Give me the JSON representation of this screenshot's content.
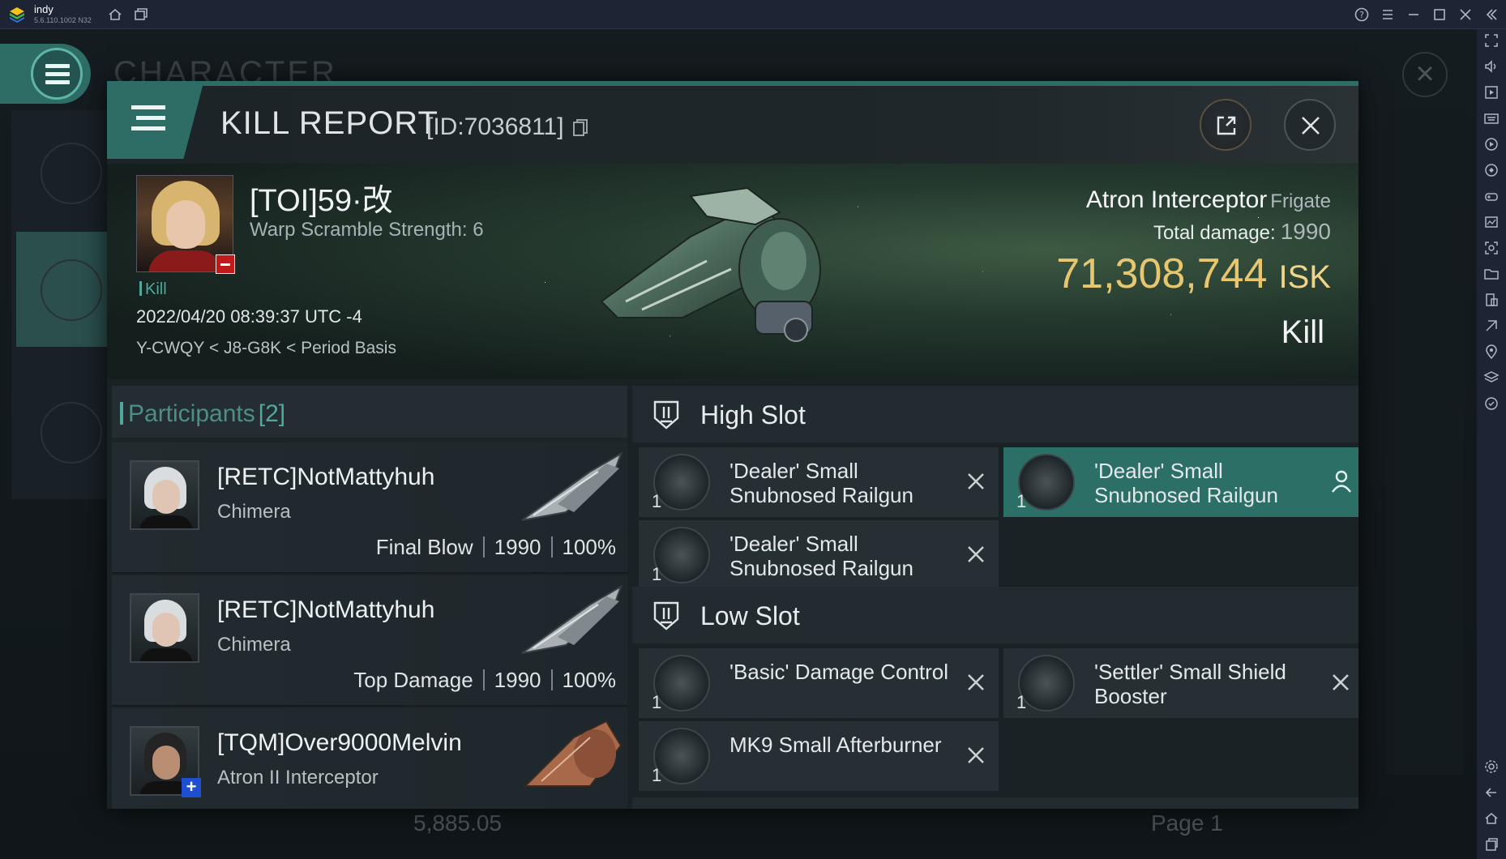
{
  "emulator": {
    "app_name": "indy",
    "app_version": "5.6.110.1002 N32"
  },
  "background": {
    "title": "CHARACTER",
    "bottom_value": "5,885.05",
    "page_label": "Page 1"
  },
  "dialog": {
    "title": "KILL REPORT",
    "id_text": "[ID:7036811]"
  },
  "victim": {
    "name": "[TOI]59·改",
    "warp_scramble": "Warp Scramble Strength: 6",
    "tag": "Kill",
    "timestamp": "2022/04/20 08:39:37 UTC -4",
    "location": "Y-CWQY < J8-G8K < Period Basis",
    "ship_name": "Atron Interceptor",
    "ship_class": "Frigate",
    "total_damage_label": "Total damage:",
    "total_damage_value": "1990",
    "isk_value": "71,308,744",
    "isk_unit": "ISK",
    "result": "Kill"
  },
  "participants": {
    "title": "Participants",
    "count": "[2]",
    "rows": [
      {
        "name": "[RETC]NotMattyhuh",
        "ship": "Chimera",
        "role": "Final Blow",
        "damage": "1990",
        "percent": "100%"
      },
      {
        "name": "[RETC]NotMattyhuh",
        "ship": "Chimera",
        "role": "Top Damage",
        "damage": "1990",
        "percent": "100%"
      },
      {
        "name": "[TQM]Over9000Melvin",
        "ship": "Atron II Interceptor"
      }
    ]
  },
  "fitting": {
    "high_slot": {
      "label": "High Slot",
      "modules": [
        {
          "qty": "1",
          "name": "'Dealer' Small Snubnosed Railgun",
          "state": "destroyed"
        },
        {
          "qty": "1",
          "name": "'Dealer' Small Snubnosed Railgun",
          "state": "dropped"
        },
        {
          "qty": "1",
          "name": "'Dealer' Small Snubnosed Railgun",
          "state": "destroyed"
        }
      ]
    },
    "low_slot": {
      "label": "Low Slot",
      "modules": [
        {
          "qty": "1",
          "name": "'Basic' Damage Control",
          "state": "destroyed"
        },
        {
          "qty": "1",
          "name": "'Settler' Small Shield Booster",
          "state": "destroyed"
        },
        {
          "qty": "1",
          "name": "MK9 Small Afterburner",
          "state": "destroyed"
        }
      ]
    }
  },
  "colors": {
    "accent": "#2e6d66",
    "isk": "#e7c66f",
    "selected_module": "#2c6f67"
  }
}
